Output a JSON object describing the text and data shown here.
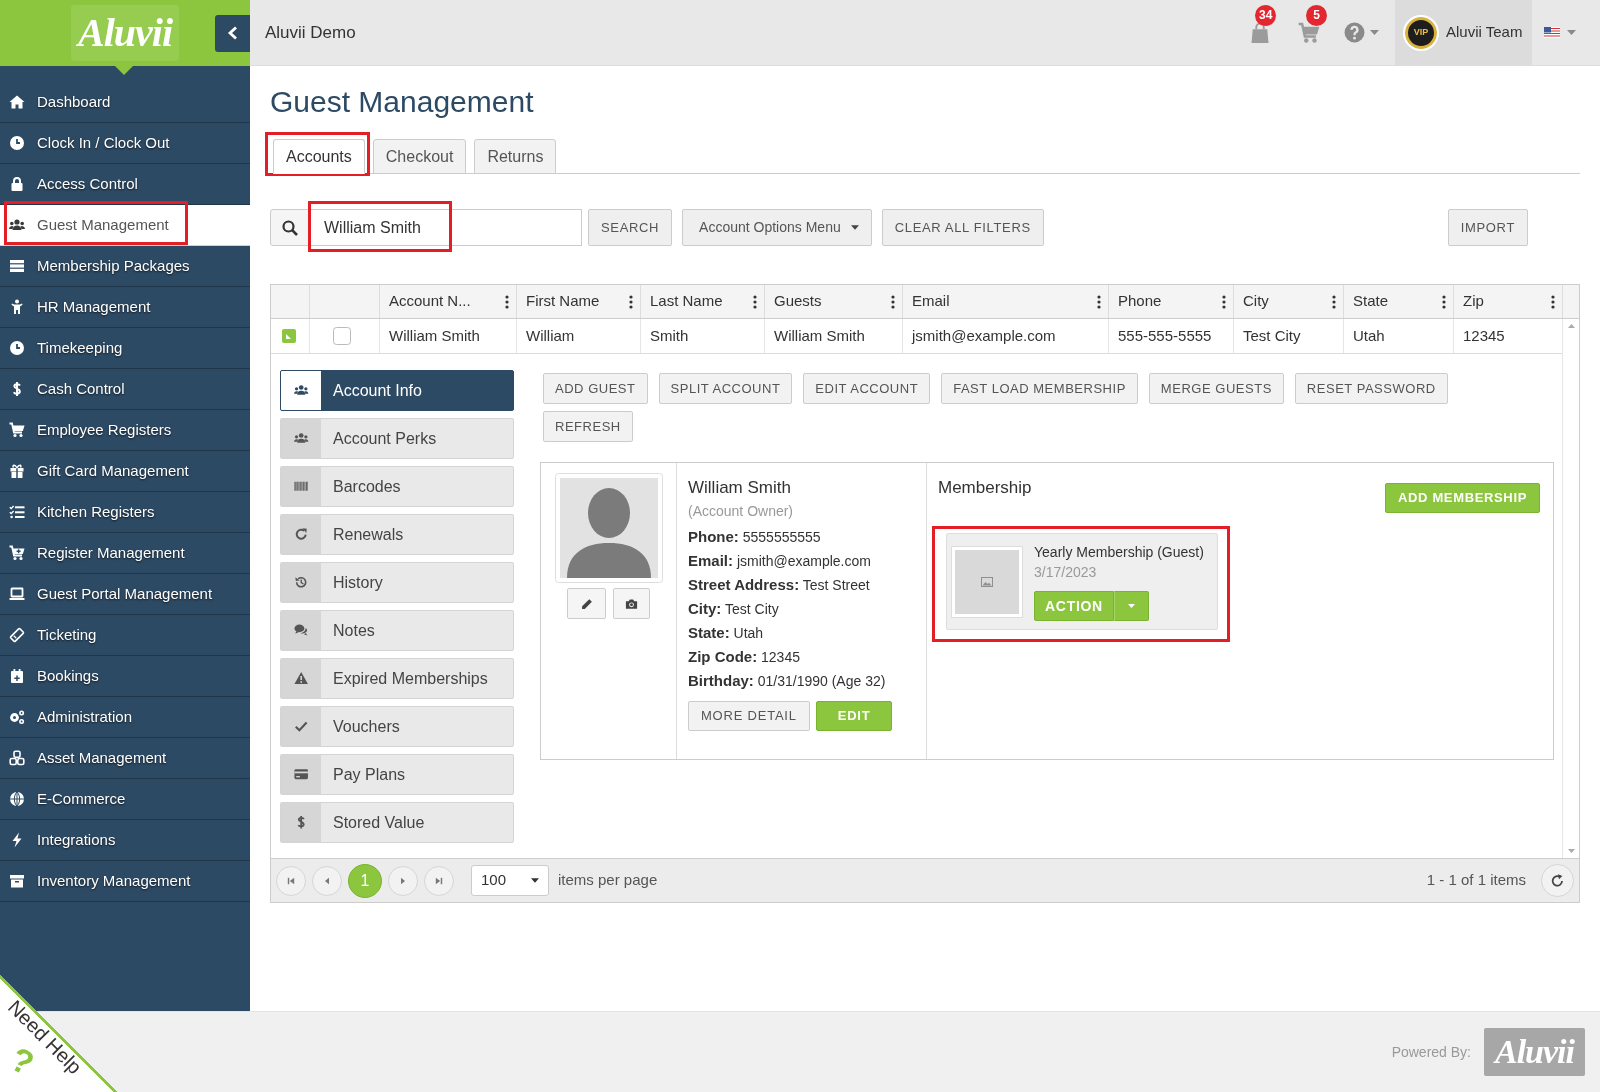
{
  "sidebar": {
    "logo": "Aluvii",
    "items": [
      {
        "label": "Dashboard",
        "selected": false,
        "highlighted": false
      },
      {
        "label": "Clock In / Clock Out",
        "selected": false,
        "highlighted": false
      },
      {
        "label": "Access Control",
        "selected": false,
        "highlighted": false
      },
      {
        "label": "Guest Management",
        "selected": true,
        "highlighted": true
      },
      {
        "label": "Membership Packages",
        "selected": false,
        "highlighted": false
      },
      {
        "label": "HR Management",
        "selected": false,
        "highlighted": false
      },
      {
        "label": "Timekeeping",
        "selected": false,
        "highlighted": false
      },
      {
        "label": "Cash Control",
        "selected": false,
        "highlighted": false
      },
      {
        "label": "Employee Registers",
        "selected": false,
        "highlighted": false
      },
      {
        "label": "Gift Card Management",
        "selected": false,
        "highlighted": false
      },
      {
        "label": "Kitchen Registers",
        "selected": false,
        "highlighted": false
      },
      {
        "label": "Register Management",
        "selected": false,
        "highlighted": false
      },
      {
        "label": "Guest Portal Management",
        "selected": false,
        "highlighted": false
      },
      {
        "label": "Ticketing",
        "selected": false,
        "highlighted": false
      },
      {
        "label": "Bookings",
        "selected": false,
        "highlighted": false
      },
      {
        "label": "Administration",
        "selected": false,
        "highlighted": false
      },
      {
        "label": "Asset Management",
        "selected": false,
        "highlighted": false
      },
      {
        "label": "E-Commerce",
        "selected": false,
        "highlighted": false
      },
      {
        "label": "Integrations",
        "selected": false,
        "highlighted": false
      },
      {
        "label": "Inventory Management",
        "selected": false,
        "highlighted": false
      }
    ]
  },
  "top_bar": {
    "title": "Aluvii Demo",
    "notifications": [
      {
        "badge": "34"
      },
      {
        "badge": "5"
      }
    ],
    "user": {
      "avatar_text": "VIP",
      "name": "Aluvii Team"
    }
  },
  "page": {
    "title": "Guest Management",
    "tabs": [
      {
        "label": "Accounts",
        "selected": true,
        "highlighted": true
      },
      {
        "label": "Checkout",
        "selected": false,
        "highlighted": false
      },
      {
        "label": "Returns",
        "selected": false,
        "highlighted": false
      }
    ],
    "search": {
      "value": "William Smith",
      "highlighted": true
    },
    "toolbar": [
      {
        "label": "SEARCH",
        "kind": "button"
      },
      {
        "label": "Account Options Menu",
        "kind": "dropdown"
      },
      {
        "label": "CLEAR ALL FILTERS",
        "kind": "button"
      }
    ],
    "import_button": "IMPORT",
    "grid": {
      "columns": [
        "Account N...",
        "First Name",
        "Last Name",
        "Guests",
        "Email",
        "Phone",
        "City",
        "State",
        "Zip"
      ],
      "rows": [
        {
          "expanded": true,
          "checked": false,
          "cells": [
            "William Smith",
            "William",
            "Smith",
            "William Smith",
            "jsmith@example.com",
            "555-555-5555",
            "Test City",
            "Utah",
            "12345"
          ],
          "detail": {
            "menu": [
              {
                "label": "Account Info",
                "selected": true
              },
              {
                "label": "Account Perks",
                "selected": false
              },
              {
                "label": "Barcodes",
                "selected": false
              },
              {
                "label": "Renewals",
                "selected": false
              },
              {
                "label": "History",
                "selected": false
              },
              {
                "label": "Notes",
                "selected": false
              },
              {
                "label": "Expired Memberships",
                "selected": false
              },
              {
                "label": "Vouchers",
                "selected": false
              },
              {
                "label": "Pay Plans",
                "selected": false
              },
              {
                "label": "Stored Value",
                "selected": false
              }
            ],
            "actions": [
              "ADD GUEST",
              "SPLIT ACCOUNT",
              "EDIT ACCOUNT",
              "FAST LOAD MEMBERSHIP",
              "MERGE GUESTS",
              "RESET PASSWORD",
              "REFRESH"
            ],
            "profile": {
              "name": "William Smith",
              "role": "(Account Owner)",
              "fields": [
                {
                  "label": "Phone:",
                  "value": "5555555555"
                },
                {
                  "label": "Email:",
                  "value": "jsmith@example.com"
                },
                {
                  "label": "Street Address:",
                  "value": "Test Street"
                },
                {
                  "label": "City:",
                  "value": "Test City"
                },
                {
                  "label": "State:",
                  "value": "Utah"
                },
                {
                  "label": "Zip Code:",
                  "value": "12345"
                },
                {
                  "label": "Birthday:",
                  "value": "01/31/1990 (Age 32)"
                }
              ],
              "buttons": [
                {
                  "label": "MORE DETAIL",
                  "kind": "secondary"
                },
                {
                  "label": "EDIT",
                  "kind": "primary"
                }
              ]
            },
            "membership": {
              "heading": "Membership",
              "add_button": "ADD MEMBERSHIP",
              "items": [
                {
                  "title": "Yearly Membership (Guest)",
                  "date": "3/17/2023",
                  "action": "ACTION",
                  "highlighted": true
                }
              ]
            }
          }
        }
      ],
      "pagination": {
        "pages": [
          {
            "label": "1",
            "selected": true
          }
        ],
        "page_size": "100",
        "page_size_label": "items per page",
        "summary": "1 - 1 of 1 items"
      }
    }
  },
  "footer": {
    "powered_by": "Powered By:",
    "logo": "Aluvii"
  },
  "help_tab": {
    "label": "Need Help",
    "mark": "?"
  }
}
